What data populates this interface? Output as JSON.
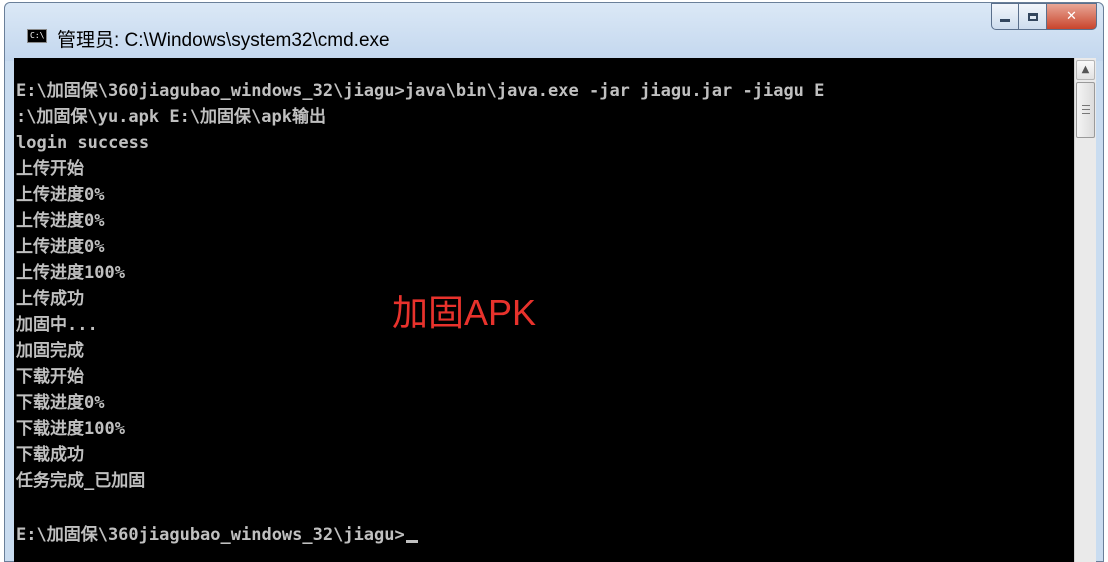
{
  "window": {
    "title": "管理员: C:\\Windows\\system32\\cmd.exe",
    "icon_text": "C:\\",
    "buttons": {
      "minimize": "minimize",
      "maximize": "maximize",
      "close": "✕"
    }
  },
  "console": {
    "lines": [
      "E:\\加固保\\360jiagubao_windows_32\\jiagu>java\\bin\\java.exe -jar jiagu.jar -jiagu E",
      ":\\加固保\\yu.apk E:\\加固保\\apk输出",
      "login success",
      "上传开始",
      "上传进度0%",
      "上传进度0%",
      "上传进度0%",
      "上传进度100%",
      "上传成功",
      "加固中...",
      "加固完成",
      "下载开始",
      "下载进度0%",
      "下载进度100%",
      "下载成功",
      "任务完成_已加固",
      "",
      "E:\\加固保\\360jiagubao_windows_32\\jiagu>"
    ],
    "annotation": "加固APK",
    "text_color": "#c0c0c0",
    "background": "#000000",
    "annotation_color": "#e8322c"
  },
  "scrollbar": {
    "up_arrow": "▲"
  }
}
